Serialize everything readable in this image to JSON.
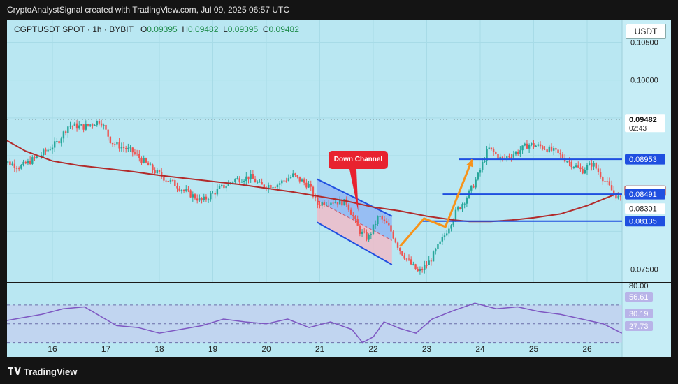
{
  "header": {
    "attribution": "CryptoAnalystSignal created with TradingView.com, Jul 09, 2025 06:57 UTC"
  },
  "symbol": {
    "name": "CGPTUSDT SPOT · 1h · BYBIT",
    "open_label": "O",
    "open": "0.09395",
    "high_label": "H",
    "high": "0.09482",
    "low_label": "L",
    "low": "0.09395",
    "close_label": "C",
    "close": "0.09482"
  },
  "currency_button": "USDT",
  "annotation": {
    "label": "Down Channel"
  },
  "footer": {
    "brand": "TradingView"
  },
  "colors": {
    "background": "#b9e7f2",
    "up_candle": "#26a69a",
    "down_candle": "#ef5350",
    "moving_average": "#b22b2b",
    "level_lines": "#1f4fe0",
    "trend_arrow": "#f7931a",
    "rsi_line": "#7e57c2"
  },
  "chart_data": {
    "type": "candlestick",
    "x_ticks": [
      "16",
      "17",
      "18",
      "19",
      "20",
      "21",
      "22",
      "23",
      "24",
      "25",
      "26"
    ],
    "y_ticks": [
      "0.10500",
      "0.10000",
      "0.07500"
    ],
    "ylim": [
      0.0732,
      0.108
    ],
    "price_labels": [
      {
        "value": "0.09482",
        "sub": "02:43",
        "kind": "current"
      },
      {
        "value": "0.08953",
        "kind": "level"
      },
      {
        "value": "0.08532",
        "kind": "ma"
      },
      {
        "value": "0.08491",
        "kind": "level"
      },
      {
        "value": "0.08301",
        "kind": "plain"
      },
      {
        "value": "0.08135",
        "kind": "level"
      }
    ],
    "horizontal_levels": [
      {
        "value": 0.08953,
        "from_day": 23.6
      },
      {
        "value": 0.08491,
        "from_day": 23.3
      },
      {
        "value": 0.08135,
        "from_day": 22.9
      }
    ],
    "trend_path": [
      [
        22.5,
        0.078
      ],
      [
        22.95,
        0.0817
      ],
      [
        23.35,
        0.0806
      ],
      [
        23.85,
        0.0895
      ]
    ],
    "channel": {
      "upper": [
        [
          20.95,
          0.0869
        ],
        [
          22.35,
          0.082
        ]
      ],
      "lower": [
        [
          20.95,
          0.0812
        ],
        [
          22.35,
          0.0756
        ]
      ],
      "mid_split": 0.5
    },
    "moving_average": [
      [
        15.0,
        0.0926
      ],
      [
        15.5,
        0.0906
      ],
      [
        16.0,
        0.0893
      ],
      [
        16.5,
        0.0887
      ],
      [
        17.0,
        0.0883
      ],
      [
        17.5,
        0.0879
      ],
      [
        18.0,
        0.0874
      ],
      [
        18.5,
        0.087
      ],
      [
        19.0,
        0.0866
      ],
      [
        19.5,
        0.0862
      ],
      [
        20.0,
        0.0857
      ],
      [
        20.5,
        0.0852
      ],
      [
        21.0,
        0.0846
      ],
      [
        21.5,
        0.084
      ],
      [
        22.0,
        0.0832
      ],
      [
        22.5,
        0.0827
      ],
      [
        23.0,
        0.082
      ],
      [
        23.5,
        0.0815
      ],
      [
        23.8,
        0.0813
      ],
      [
        24.2,
        0.0813
      ],
      [
        24.6,
        0.0815
      ],
      [
        25.0,
        0.0818
      ],
      [
        25.5,
        0.0823
      ],
      [
        26.0,
        0.0834
      ],
      [
        26.6,
        0.0851
      ]
    ],
    "price_path": [
      [
        15.0,
        0.0895
      ],
      [
        15.4,
        0.0885
      ],
      [
        15.8,
        0.0902
      ],
      [
        16.1,
        0.0918
      ],
      [
        16.3,
        0.094
      ],
      [
        16.6,
        0.0938
      ],
      [
        16.9,
        0.0947
      ],
      [
        17.1,
        0.0918
      ],
      [
        17.5,
        0.0905
      ],
      [
        17.9,
        0.088
      ],
      [
        18.1,
        0.087
      ],
      [
        18.3,
        0.0862
      ],
      [
        18.5,
        0.0852
      ],
      [
        18.8,
        0.084
      ],
      [
        19.1,
        0.0855
      ],
      [
        19.4,
        0.0868
      ],
      [
        19.7,
        0.0872
      ],
      [
        19.9,
        0.086
      ],
      [
        20.2,
        0.0862
      ],
      [
        20.5,
        0.0874
      ],
      [
        20.8,
        0.086
      ],
      [
        20.95,
        0.0836
      ],
      [
        21.2,
        0.084
      ],
      [
        21.5,
        0.0838
      ],
      [
        21.75,
        0.08
      ],
      [
        21.9,
        0.079
      ],
      [
        22.1,
        0.082
      ],
      [
        22.3,
        0.0805
      ],
      [
        22.5,
        0.0775
      ],
      [
        22.7,
        0.0757
      ],
      [
        22.85,
        0.0745
      ],
      [
        23.05,
        0.076
      ],
      [
        23.3,
        0.079
      ],
      [
        23.55,
        0.0826
      ],
      [
        23.75,
        0.0845
      ],
      [
        23.95,
        0.0872
      ],
      [
        24.15,
        0.091
      ],
      [
        24.4,
        0.0895
      ],
      [
        24.7,
        0.0905
      ],
      [
        24.9,
        0.0915
      ],
      [
        25.15,
        0.0912
      ],
      [
        25.4,
        0.0905
      ],
      [
        25.6,
        0.0895
      ],
      [
        25.9,
        0.088
      ],
      [
        26.1,
        0.089
      ],
      [
        26.3,
        0.087
      ],
      [
        26.5,
        0.085
      ],
      [
        26.65,
        0.084
      ]
    ],
    "rsi": {
      "levels": [
        "80.00",
        "56.61",
        "30.19",
        "27.73"
      ],
      "band_upper": 70,
      "band_lower": 30,
      "path": [
        [
          15.0,
          52
        ],
        [
          15.4,
          56
        ],
        [
          15.8,
          60
        ],
        [
          16.2,
          66
        ],
        [
          16.6,
          68
        ],
        [
          16.9,
          58
        ],
        [
          17.2,
          48
        ],
        [
          17.6,
          46
        ],
        [
          18.0,
          40
        ],
        [
          18.4,
          44
        ],
        [
          18.8,
          48
        ],
        [
          19.2,
          55
        ],
        [
          19.6,
          52
        ],
        [
          20.0,
          50
        ],
        [
          20.4,
          55
        ],
        [
          20.8,
          46
        ],
        [
          21.2,
          52
        ],
        [
          21.6,
          44
        ],
        [
          21.8,
          30
        ],
        [
          22.0,
          36
        ],
        [
          22.2,
          52
        ],
        [
          22.5,
          45
        ],
        [
          22.8,
          40
        ],
        [
          23.1,
          55
        ],
        [
          23.5,
          64
        ],
        [
          23.9,
          72
        ],
        [
          24.3,
          66
        ],
        [
          24.7,
          68
        ],
        [
          25.1,
          63
        ],
        [
          25.5,
          60
        ],
        [
          25.9,
          55
        ],
        [
          26.3,
          50
        ],
        [
          26.65,
          40
        ]
      ]
    }
  }
}
